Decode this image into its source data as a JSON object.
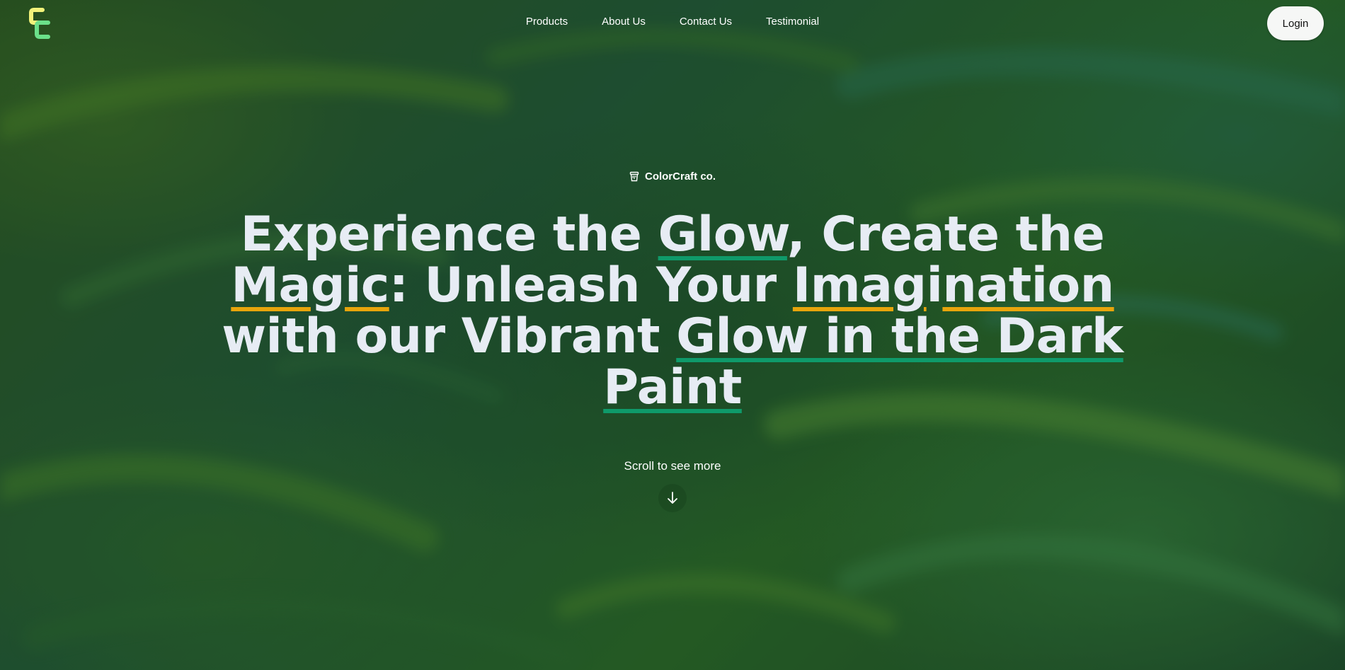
{
  "nav": {
    "logo_icon": "colorcraft-cc-logo-icon",
    "links": [
      {
        "label": "Products"
      },
      {
        "label": "About Us"
      },
      {
        "label": "Contact Us"
      },
      {
        "label": "Testimonial"
      }
    ],
    "login_label": "Login"
  },
  "brand": {
    "icon": "paint-bucket-icon",
    "name": "ColorCraft co."
  },
  "headline": {
    "p1": "Experience the ",
    "glow": "Glow",
    "p2": ", Create the ",
    "ma": "Ma",
    "g1": "g",
    "ic": "ic",
    "p3": ": Unleash Your ",
    "imag": "Imag",
    "i1": "i",
    "nation": "nation",
    "p4": " with our Vibrant ",
    "glow_paint": "Glow in the Dark Paint"
  },
  "scroll": {
    "label": "Scroll to see more",
    "icon": "arrow-down-icon"
  },
  "colors": {
    "underline_green": "#0f9a6a",
    "underline_yellow": "#e8a50c",
    "headline_text": "#e7ecf4",
    "logo_yellow": "#f2f27a",
    "logo_green": "#6be08a"
  }
}
